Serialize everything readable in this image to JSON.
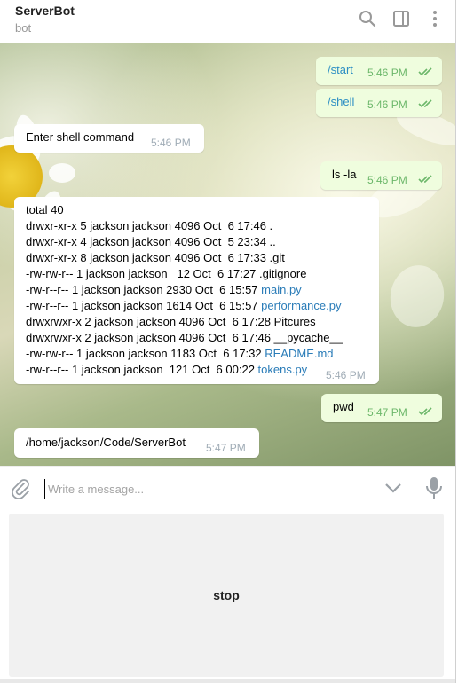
{
  "header": {
    "title": "ServerBot",
    "subtitle": "bot",
    "icons": [
      "search-icon",
      "sidebar-toggle-icon",
      "more-vert-icon"
    ]
  },
  "messages": [
    {
      "dir": "out",
      "text": "/start",
      "time": "5:46 PM"
    },
    {
      "dir": "out",
      "text": "/shell",
      "time": "5:46 PM"
    },
    {
      "dir": "in",
      "text": "Enter shell command",
      "time": "5:46 PM"
    },
    {
      "dir": "out",
      "text": "ls -la",
      "time": "5:46 PM"
    },
    {
      "dir": "in",
      "time": "5:46 PM",
      "lines": [
        {
          "text": "total 40",
          "link": ""
        },
        {
          "text": "drwxr-xr-x 5 jackson jackson 4096 Oct  6 17:46 .",
          "link": ""
        },
        {
          "text": "drwxr-xr-x 4 jackson jackson 4096 Oct  5 23:34 ..",
          "link": ""
        },
        {
          "text": "drwxr-xr-x 8 jackson jackson 4096 Oct  6 17:33 .git",
          "link": ""
        },
        {
          "text": "-rw-rw-r-- 1 jackson jackson   12 Oct  6 17:27 .gitignore",
          "link": ""
        },
        {
          "text": "-rw-r--r-- 1 jackson jackson 2930 Oct  6 15:57 ",
          "link": "main.py"
        },
        {
          "text": "-rw-r--r-- 1 jackson jackson 1614 Oct  6 15:57 ",
          "link": "performance.py"
        },
        {
          "text": "drwxrwxr-x 2 jackson jackson 4096 Oct  6 17:28 Pitcures",
          "link": ""
        },
        {
          "text": "drwxrwxr-x 2 jackson jackson 4096 Oct  6 17:46 __pycache__",
          "link": ""
        },
        {
          "text": "-rw-rw-r-- 1 jackson jackson 1183 Oct  6 17:32 ",
          "link": "README.md"
        },
        {
          "text": "-rw-r--r-- 1 jackson jackson  121 Oct  6 00:22 ",
          "link": "tokens.py"
        }
      ]
    },
    {
      "dir": "out",
      "text": "pwd",
      "time": "5:47 PM"
    },
    {
      "dir": "in",
      "text": "/home/jackson/Code/ServerBot",
      "time": "5:47 PM"
    }
  ],
  "composer": {
    "placeholder": "Write a message...",
    "icons": [
      "attach-icon",
      "chevron-down-icon",
      "microphone-icon"
    ]
  },
  "keyboard": {
    "buttons": [
      "stop"
    ]
  },
  "colors": {
    "outgoing_bubble": "#effdde",
    "incoming_bubble": "#ffffff",
    "link": "#2a7cb8",
    "read_ticks": "#6cb76a"
  }
}
